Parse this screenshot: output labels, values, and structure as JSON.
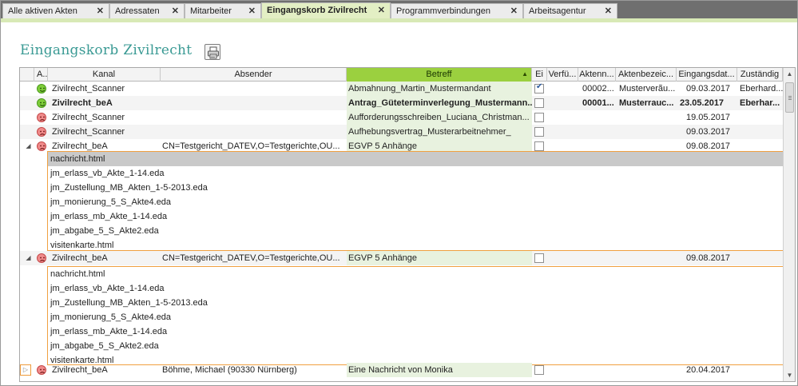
{
  "tabs": [
    {
      "label": "Alle aktiven Akten",
      "close": "✕",
      "active": false
    },
    {
      "label": "Adressaten",
      "close": "✕",
      "active": false
    },
    {
      "label": "Mitarbeiter",
      "close": "✕",
      "active": false
    },
    {
      "label": "Eingangskorb Zivilrecht",
      "close": "✕",
      "active": true
    },
    {
      "label": "Programmverbindungen",
      "close": "✕",
      "active": false
    },
    {
      "label": "Arbeitsagentur",
      "close": "✕",
      "active": false
    }
  ],
  "page": {
    "title": "Eingangskorb Zivilrecht",
    "print_icon": "print-icon"
  },
  "columns": {
    "a": "A...",
    "kanal": "Kanal",
    "absender": "Absender",
    "betreff": "Betreff",
    "ei": "Ei",
    "verfue": "Verfü...",
    "aktennr": "Aktenn...",
    "aktenbez": "Aktenbezeic...",
    "eingang": "Eingangsdat...",
    "zustaendig": "Zuständig",
    "sort_arrow": "▲"
  },
  "rows": [
    {
      "face": "happy",
      "kanal": "Zivilrecht_Scanner",
      "absender": "",
      "betreff": "Abmahnung_Martin_Mustermandant",
      "checked": true,
      "aktennr": "00002...",
      "aktenbez": "Musterverãu...",
      "eingang": "09.03.2017",
      "zustaendig": "Eberhard..."
    },
    {
      "face": "happy",
      "kanal": "Zivilrecht_beA",
      "absender": "",
      "betreff": "Antrag_Güteterminverlegung_Mustermann...",
      "checked": false,
      "aktennr": "00001...",
      "aktenbez": "Musterrauc...",
      "eingang": "23.05.2017",
      "zustaendig": "Eberhar...",
      "bold": true
    },
    {
      "face": "sad",
      "kanal": "Zivilrecht_Scanner",
      "absender": "",
      "betreff": "Aufforderungsschreiben_Luciana_Christman...",
      "checked": false,
      "aktennr": "",
      "aktenbez": "",
      "eingang": "19.05.2017",
      "zustaendig": ""
    },
    {
      "face": "sad",
      "kanal": "Zivilrecht_Scanner",
      "absender": "",
      "betreff": "Aufhebungsvertrag_Musterarbeitnehmer_",
      "checked": false,
      "aktennr": "",
      "aktenbez": "",
      "eingang": "09.03.2017",
      "zustaendig": ""
    },
    {
      "face": "sad",
      "expander": "◢",
      "kanal": "Zivilrecht_beA",
      "absender": "CN=Testgericht_DATEV,O=Testgerichte,OU...",
      "betreff": "EGVP 5 Anhänge",
      "checked": false,
      "aktennr": "",
      "aktenbez": "",
      "eingang": "09.08.2017",
      "zustaendig": ""
    },
    {
      "face": "sad",
      "expander": "◢",
      "kanal": "Zivilrecht_beA",
      "absender": "CN=Testgericht_DATEV,O=Testgerichte,OU...",
      "betreff": "EGVP 5 Anhänge",
      "checked": false,
      "aktennr": "",
      "aktenbez": "",
      "eingang": "09.08.2017",
      "zustaendig": ""
    },
    {
      "face": "sad",
      "expander": "▷",
      "kanal": "Zivilrecht_beA",
      "absender": "Böhme, Michael (90330 Nürnberg)",
      "betreff": "Eine Nachricht von Monika",
      "checked": false,
      "aktennr": "",
      "aktenbez": "",
      "eingang": "20.04.2017",
      "zustaendig": ""
    }
  ],
  "attachments_1": [
    "nachricht.html",
    "jm_erlass_vb_Akte_1-14.eda",
    "jm_Zustellung_MB_Akten_1-5-2013.eda",
    "jm_monierung_5_S_Akte4.eda",
    "jm_erlass_mb_Akte_1-14.eda",
    "jm_abgabe_5_S_Akte2.eda",
    "visitenkarte.html"
  ],
  "attachments_2": [
    "nachricht.html",
    "jm_erlass_vb_Akte_1-14.eda",
    "jm_Zustellung_MB_Akten_1-5-2013.eda",
    "jm_monierung_5_S_Akte4.eda",
    "jm_erlass_mb_Akte_1-14.eda",
    "jm_abgabe_5_S_Akte2.eda",
    "visitenkarte.html"
  ],
  "scrollbar": {
    "up": "▲",
    "down": "▼"
  },
  "colors": {
    "accent": "#3a9a94",
    "sorted_header": "#9bd03f",
    "active_tab": "#e3efc4",
    "highlight_border": "#f0a040"
  }
}
